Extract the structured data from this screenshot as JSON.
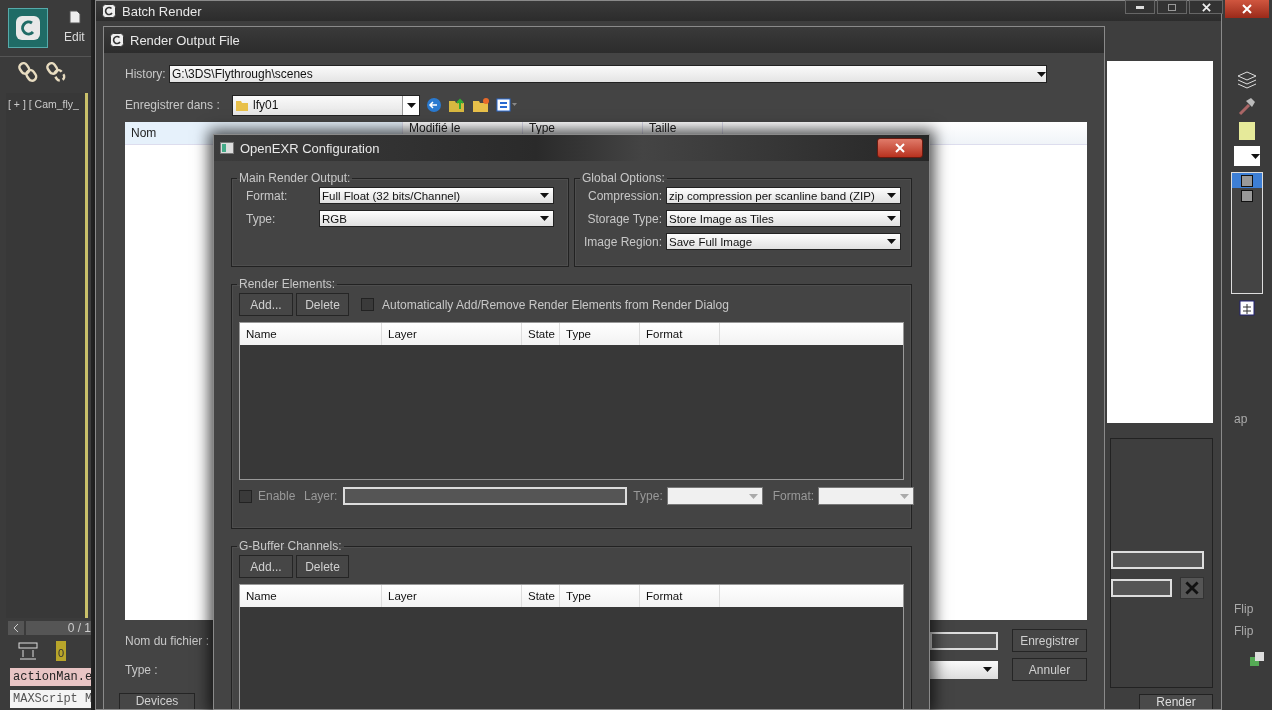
{
  "app": {
    "menu": "Edit",
    "viewport_label": "[ + ] [ Cam_fly_",
    "frame_counter": "0 / 1",
    "time_marker": "0",
    "listener_fields": [
      {
        "kind": "macro",
        "value": "actionMan.e"
      },
      {
        "kind": "listener",
        "value": "MAXScript M"
      }
    ],
    "side_labels": [
      "ap",
      "Flip",
      "Flip"
    ]
  },
  "batch_render": {
    "title": "Batch Render",
    "render_button": "Render"
  },
  "render_output_file": {
    "title": "Render Output File",
    "history_label": "History:",
    "history_value": "G:\\3DS\\Flythrough\\scenes",
    "save_in_label": "Enregistrer dans :",
    "save_in_value": "lfy01",
    "columns": [
      "Nom",
      "Modifié le",
      "Type",
      "Taille"
    ],
    "file_name_label": "Nom du fichier :",
    "type_label": "Type :",
    "buttons": [
      "Enregistrer",
      "Annuler"
    ],
    "devices_button": "Devices"
  },
  "openexr": {
    "title": "OpenEXR Configuration",
    "main_render_output": {
      "legend": "Main Render Output:",
      "fields": [
        {
          "label": "Format:",
          "value": "Full Float (32 bits/Channel)"
        },
        {
          "label": "Type:",
          "value": "RGB"
        }
      ]
    },
    "global_options": {
      "legend": "Global Options:",
      "fields": [
        {
          "label": "Compression:",
          "value": "zip compression per scanline band (ZIP)"
        },
        {
          "label": "Storage Type:",
          "value": "Store Image as Tiles"
        },
        {
          "label": "Image Region:",
          "value": "Save Full Image"
        }
      ]
    },
    "render_elements": {
      "legend": "Render Elements:",
      "buttons": [
        "Add...",
        "Delete"
      ],
      "auto_option": {
        "label": "Automatically Add/Remove Render Elements from Render Dialog",
        "checked": false
      },
      "columns": [
        "Name",
        "Layer",
        "State",
        "Type",
        "Format"
      ],
      "enable": {
        "label": "Enable",
        "checked": false
      },
      "layer_label": "Layer:",
      "type_label": "Type:",
      "format_label": "Format:"
    },
    "gbuffer_channels": {
      "legend": "G-Buffer Channels:",
      "buttons": [
        "Add...",
        "Delete"
      ],
      "columns": [
        "Name",
        "Layer",
        "State",
        "Type",
        "Format"
      ]
    }
  }
}
